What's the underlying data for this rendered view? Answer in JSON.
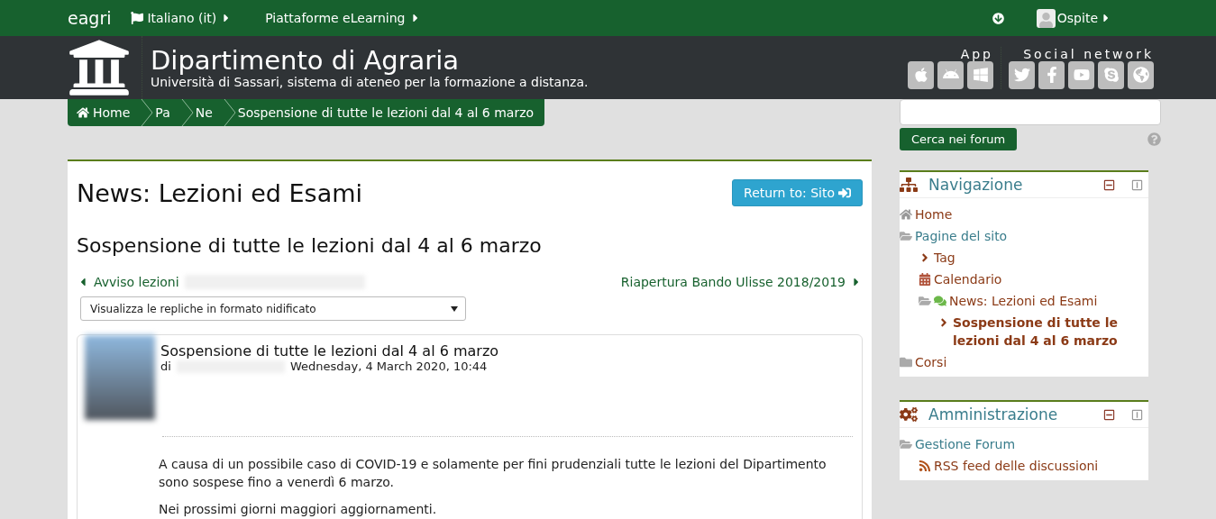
{
  "top_bar": {
    "brand": "eagri",
    "menus": [
      {
        "label": "Italiano (it)",
        "kind": "language"
      },
      {
        "label": "Piattaforme eLearning",
        "kind": "plain"
      }
    ],
    "user": "Ospite"
  },
  "header": {
    "title": "Dipartimento di Agraria",
    "subtitle": "Università di Sassari, sistema di ateneo per la formazione a distanza.",
    "app_label": "App",
    "social_label": "Social network"
  },
  "breadcrumb": [
    {
      "label": "Home",
      "kind": "home"
    },
    {
      "label": "Pa",
      "kind": "plain"
    },
    {
      "label": "Ne",
      "kind": "plain"
    },
    {
      "label": "Sospensione di tutte le lezioni dal 4 al 6 marzo",
      "kind": "plain"
    }
  ],
  "search": {
    "button": "Cerca nei forum"
  },
  "main": {
    "heading": "News: Lezioni ed Esami",
    "return_button": "Return to: Sito",
    "discussion_title": "Sospensione di tutte le lezioni dal 4 al 6 marzo",
    "prev_link": "Avviso lezioni",
    "next_link": "Riapertura Bando Ulisse 2018/2019",
    "display_mode": "Visualizza le repliche in formato nidificato"
  },
  "post": {
    "subject": "Sospensione di tutte le lezioni dal 4 al 6 marzo",
    "by": "di",
    "date": "Wednesday, 4 March 2020, 10:44",
    "paragraphs": [
      "A causa di un possibile caso di COVID-19 e solamente per fini prudenziali tutte le lezioni del Dipartimento sono sospese fino a venerdì 6 marzo.",
      "Nei prossimi giorni maggiori aggiornamenti."
    ]
  },
  "navigation": {
    "title": "Navigazione",
    "items": [
      {
        "label": "Home",
        "kind": "home",
        "link": true,
        "selected": false
      },
      {
        "label": "Pagine del sito",
        "kind": "folder-open",
        "link": false,
        "selected": false,
        "children": [
          {
            "label": "Tag",
            "kind": "chevron",
            "link": true,
            "selected": false
          },
          {
            "label": "Calendario",
            "kind": "calendar",
            "link": true,
            "selected": false
          },
          {
            "label": "News: Lezioni ed Esami",
            "kind": "forum",
            "link": true,
            "selected": false,
            "children": [
              {
                "label": "Sospensione di tutte le lezioni dal 4 al 6 marzo",
                "kind": "chevron",
                "link": true,
                "selected": true
              }
            ]
          }
        ]
      },
      {
        "label": "Corsi",
        "kind": "folder",
        "link": true,
        "selected": false
      }
    ]
  },
  "administration": {
    "title": "Amministrazione",
    "items": [
      {
        "label": "Gestione Forum",
        "kind": "folder-open",
        "link": false,
        "selected": false,
        "children": [
          {
            "label": "RSS feed delle discussioni",
            "kind": "rss",
            "link": true,
            "selected": false
          }
        ]
      }
    ]
  }
}
